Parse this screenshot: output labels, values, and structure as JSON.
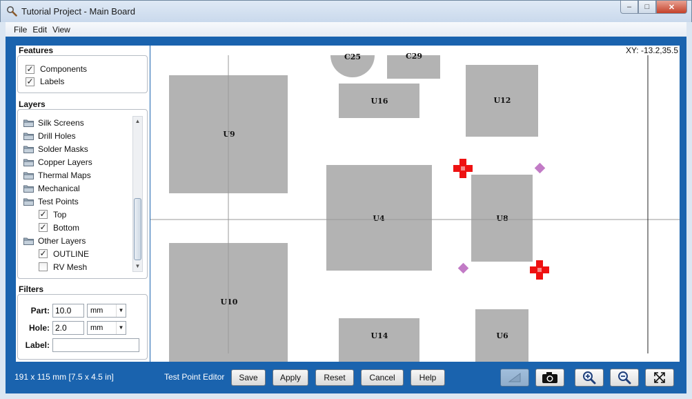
{
  "window": {
    "title": "Tutorial Project - Main Board",
    "minimize": "‒",
    "restore": "□",
    "close": "✕"
  },
  "menu": [
    "File",
    "Edit",
    "View"
  ],
  "features": {
    "title": "Features",
    "items": [
      {
        "label": "Components",
        "checked": true
      },
      {
        "label": "Labels",
        "checked": true
      }
    ]
  },
  "layers": {
    "title": "Layers",
    "items": [
      {
        "label": "Silk Screens",
        "kind": "folder"
      },
      {
        "label": "Drill Holes",
        "kind": "folder"
      },
      {
        "label": "Solder Masks",
        "kind": "folder"
      },
      {
        "label": "Copper Layers",
        "kind": "folder"
      },
      {
        "label": "Thermal Maps",
        "kind": "folder"
      },
      {
        "label": "Mechanical",
        "kind": "folder"
      },
      {
        "label": "Test Points",
        "kind": "folder"
      },
      {
        "label": "Top",
        "kind": "check",
        "checked": true
      },
      {
        "label": "Bottom",
        "kind": "check",
        "checked": true
      },
      {
        "label": "Other Layers",
        "kind": "folder"
      },
      {
        "label": "OUTLINE",
        "kind": "check",
        "checked": true
      },
      {
        "label": "RV Mesh",
        "kind": "check",
        "checked": false
      }
    ]
  },
  "filters": {
    "title": "Filters",
    "part_label": "Part:",
    "part_value": "10.0",
    "part_unit": "mm",
    "hole_label": "Hole:",
    "hole_value": "2.0",
    "hole_unit": "mm",
    "label_label": "Label:",
    "label_value": ""
  },
  "canvas": {
    "xy_readout": "XY: -13.2,35.5",
    "components": [
      "C25",
      "C29",
      "U16",
      "U12",
      "U9",
      "U4",
      "U8",
      "U10",
      "U14",
      "U6"
    ]
  },
  "status": {
    "size": "191 x 115 mm  [7.5 x 4.5 in]",
    "editor": "Test Point Editor"
  },
  "buttons": {
    "save": "Save",
    "apply": "Apply",
    "reset": "Reset",
    "cancel": "Cancel",
    "help": "Help"
  },
  "toolbar_icons": [
    "ruler-icon",
    "camera-icon",
    "zoom-in-icon",
    "zoom-out-icon",
    "fit-to-view-icon"
  ],
  "colors": {
    "frame_blue": "#1a63ae",
    "component_gray": "#b3b3b3",
    "test_point_red": "#ee1111",
    "test_point_purple": "#c27bc6"
  }
}
